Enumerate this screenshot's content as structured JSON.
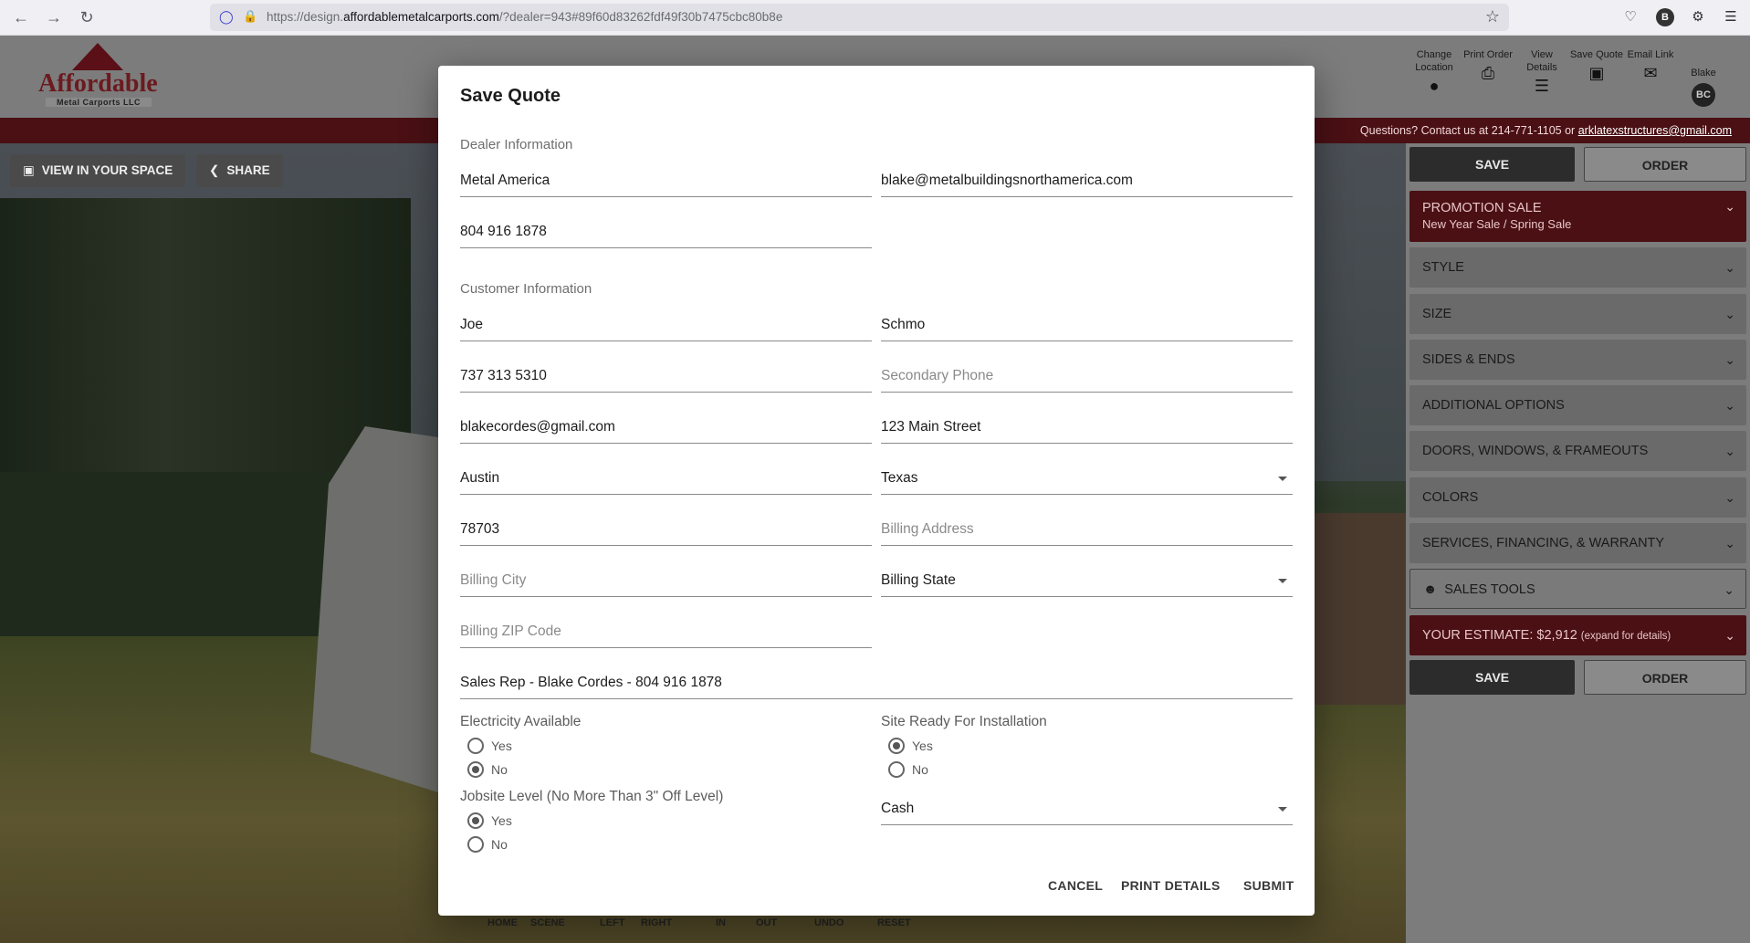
{
  "browser": {
    "url_prefix": "https://design.",
    "url_domain": "affordablemetalcarports.com",
    "url_rest": "/?dealer=943#89f60d83262fdf49f30b7475cbc80b8e"
  },
  "app": {
    "logo": {
      "word": "Affordable",
      "sub": "Metal Carports LLC"
    },
    "header_buttons": [
      {
        "label": "Change Location",
        "icon": "location-pin-icon"
      },
      {
        "label": "Print Order",
        "icon": "printer-icon"
      },
      {
        "label": "View Details",
        "icon": "list-icon"
      },
      {
        "label": "Save Quote",
        "icon": "document-icon"
      },
      {
        "label": "Email Link",
        "icon": "envelope-icon"
      },
      {
        "label": "Blake",
        "initials": "BC"
      }
    ],
    "contact_text": "Questions? Contact us at 214-771-1105 or ",
    "contact_email": "arklatexstructures@gmail.com"
  },
  "scene": {
    "view_in_space": "VIEW IN YOUR SPACE",
    "share": "SHARE",
    "controls": [
      "HOME",
      "SCENE",
      "LEFT",
      "RIGHT",
      "IN",
      "OUT",
      "UNDO",
      "RESET"
    ]
  },
  "panel": {
    "save": "SAVE",
    "order": "ORDER",
    "promo_title": "PROMOTION SALE",
    "promo_sub": "New Year Sale / Spring Sale",
    "sections": [
      "STYLE",
      "SIZE",
      "SIDES & ENDS",
      "ADDITIONAL OPTIONS",
      "DOORS, WINDOWS, & FRAMEOUTS",
      "COLORS",
      "SERVICES, FINANCING, & WARRANTY"
    ],
    "sales_tools": "SALES TOOLS",
    "estimate": "YOUR ESTIMATE: $2,912",
    "estimate_note": "(expand for details)"
  },
  "modal": {
    "title": "Save Quote",
    "dealer_header": "Dealer Information",
    "dealer_name": "Metal America",
    "dealer_email": "blake@metalbuildingsnorthamerica.com",
    "dealer_phone": "804 916 1878",
    "customer_header": "Customer Information",
    "first_name": "Joe",
    "last_name": "Schmo",
    "phone": "737 313 5310",
    "secondary_phone_placeholder": "Secondary Phone",
    "email": "blakecordes@gmail.com",
    "address": "123 Main Street",
    "city": "Austin",
    "state": "Texas",
    "zip": "78703",
    "billing_address_placeholder": "Billing Address",
    "billing_city_placeholder": "Billing City",
    "billing_state": "Billing State",
    "billing_zip_placeholder": "Billing ZIP Code",
    "sales_rep": "Sales Rep - Blake Cordes - 804 916 1878",
    "electricity_label": "Electricity Available",
    "electricity_selected": "No",
    "site_ready_label": "Site Ready For Installation",
    "site_ready_selected": "Yes",
    "jobsite_label": "Jobsite Level (No More Than 3\" Off Level)",
    "jobsite_selected": "Yes",
    "yes": "Yes",
    "no": "No",
    "payment": "Cash",
    "cancel": "CANCEL",
    "print_details": "PRINT DETAILS",
    "submit": "SUBMIT"
  }
}
